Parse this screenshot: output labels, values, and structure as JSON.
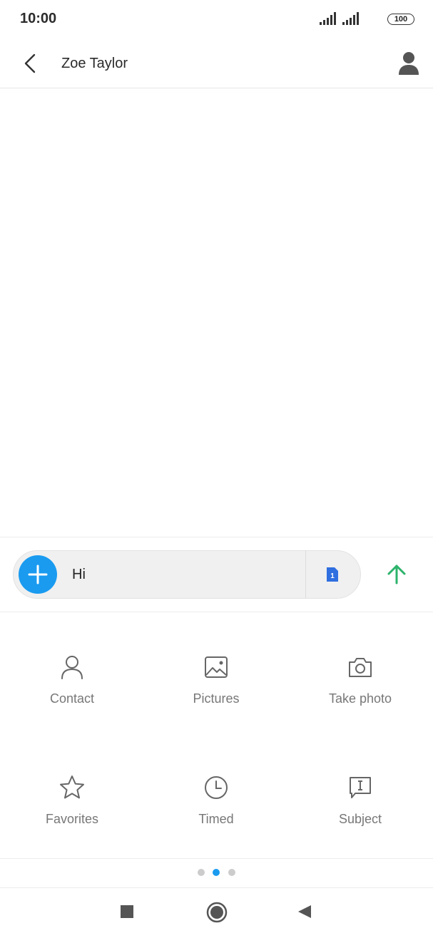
{
  "status_bar": {
    "time": "10:00",
    "battery": "100"
  },
  "header": {
    "contact_name": "Zoe Taylor"
  },
  "compose": {
    "message_value": "Hi",
    "sim_number": "1"
  },
  "attachments": [
    {
      "label": "Contact",
      "icon": "person-icon"
    },
    {
      "label": "Pictures",
      "icon": "image-icon"
    },
    {
      "label": "Take photo",
      "icon": "camera-icon"
    },
    {
      "label": "Favorites",
      "icon": "star-icon"
    },
    {
      "label": "Timed",
      "icon": "clock-icon"
    },
    {
      "label": "Subject",
      "icon": "subject-icon"
    }
  ],
  "pager": {
    "total": 3,
    "active": 2
  },
  "colors": {
    "accent_blue": "#1a9bf0",
    "send_green": "#2db36b",
    "sim_blue": "#2f6fe0",
    "icon_gray": "#666666",
    "label_gray": "#777777"
  }
}
